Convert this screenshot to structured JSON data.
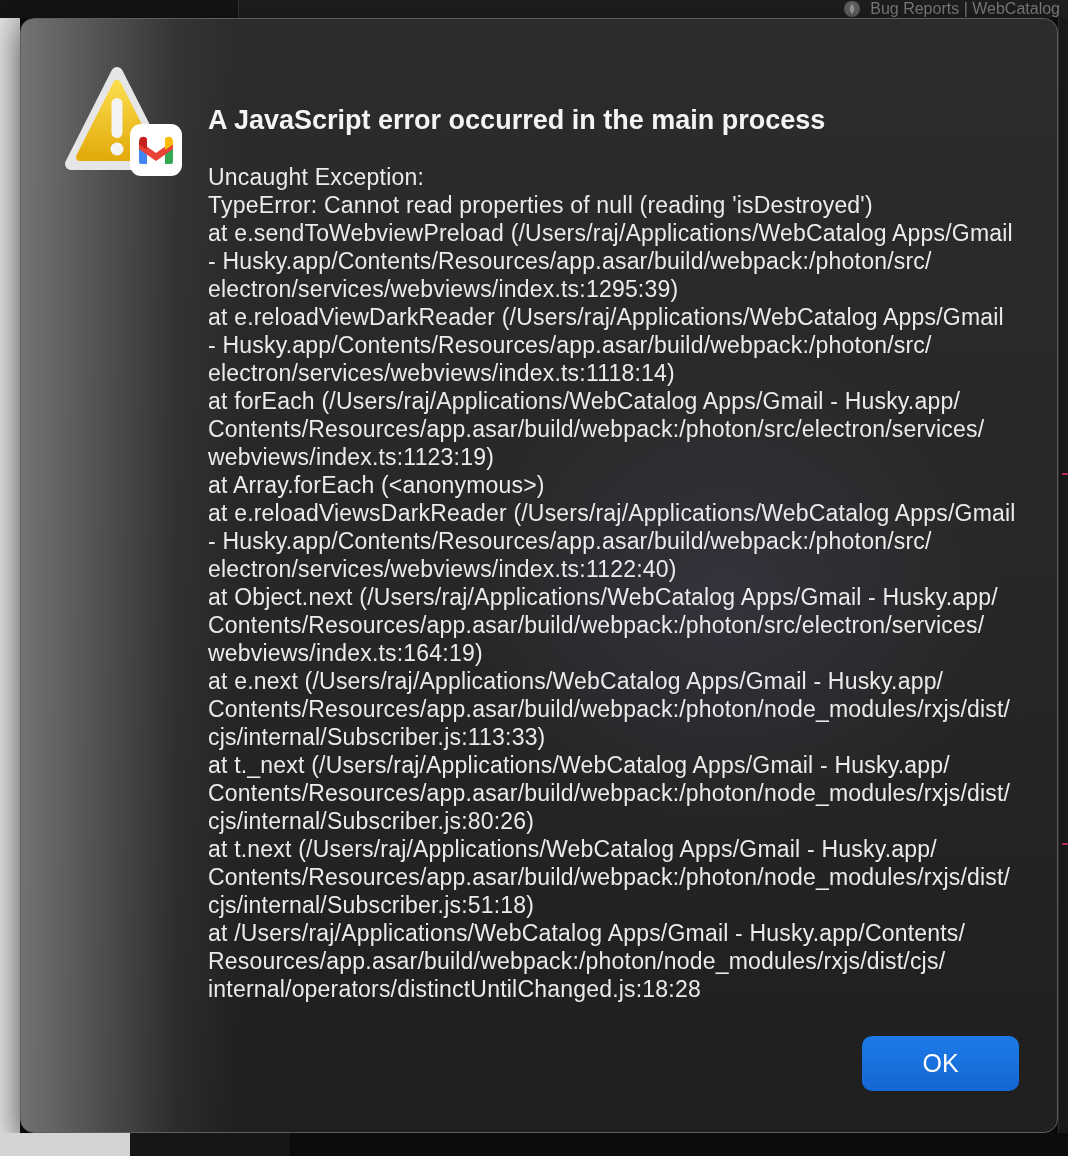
{
  "browser_tab": {
    "title": "Bug Reports | WebCatalog"
  },
  "dialog": {
    "title": "A JavaScript error occurred in the main process",
    "message": "Uncaught Exception:\nTypeError: Cannot read properties of null (reading 'isDestroyed')\nat e.sendToWebviewPreload (/Users/raj/Applications/WebCatalog Apps/Gmail\n- Husky.app/Contents/Resources/app.asar/build/webpack:/photon/src/\nelectron/services/webviews/index.ts:1295:39)\nat e.reloadViewDarkReader (/Users/raj/Applications/WebCatalog Apps/Gmail\n- Husky.app/Contents/Resources/app.asar/build/webpack:/photon/src/\nelectron/services/webviews/index.ts:1118:14)\nat forEach (/Users/raj/Applications/WebCatalog Apps/Gmail - Husky.app/\nContents/Resources/app.asar/build/webpack:/photon/src/electron/services/\nwebviews/index.ts:1123:19)\nat Array.forEach (<anonymous>)\nat e.reloadViewsDarkReader (/Users/raj/Applications/WebCatalog Apps/Gmail\n- Husky.app/Contents/Resources/app.asar/build/webpack:/photon/src/\nelectron/services/webviews/index.ts:1122:40)\nat Object.next (/Users/raj/Applications/WebCatalog Apps/Gmail - Husky.app/\nContents/Resources/app.asar/build/webpack:/photon/src/electron/services/\nwebviews/index.ts:164:19)\nat e.next (/Users/raj/Applications/WebCatalog Apps/Gmail - Husky.app/\nContents/Resources/app.asar/build/webpack:/photon/node_modules/rxjs/dist/\ncjs/internal/Subscriber.js:113:33)\nat t._next (/Users/raj/Applications/WebCatalog Apps/Gmail - Husky.app/\nContents/Resources/app.asar/build/webpack:/photon/node_modules/rxjs/dist/\ncjs/internal/Subscriber.js:80:26)\nat t.next (/Users/raj/Applications/WebCatalog Apps/Gmail - Husky.app/\nContents/Resources/app.asar/build/webpack:/photon/node_modules/rxjs/dist/\ncjs/internal/Subscriber.js:51:18)\nat /Users/raj/Applications/WebCatalog Apps/Gmail - Husky.app/Contents/\nResources/app.asar/build/webpack:/photon/node_modules/rxjs/dist/cjs/\ninternal/operators/distinctUntilChanged.js:18:28",
    "buttons": [
      {
        "label": "OK",
        "default": true
      }
    ]
  }
}
